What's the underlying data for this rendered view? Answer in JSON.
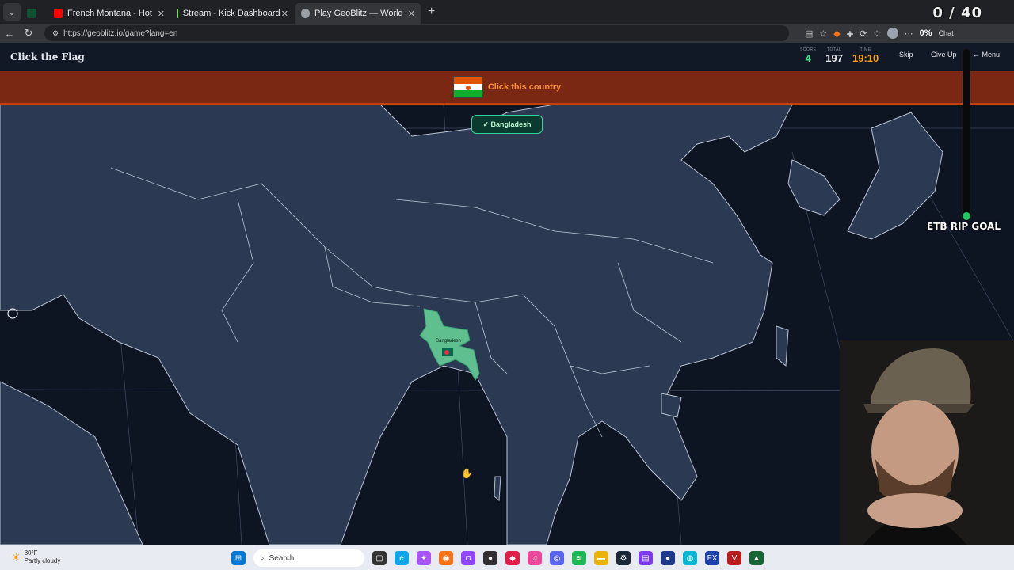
{
  "browser": {
    "tabs": [
      {
        "label": "",
        "color": "#0f5132"
      },
      {
        "label": "French Montana - Hot Boy Bling ft",
        "color": "#ff0000"
      },
      {
        "label": "Stream - Kick Dashboard",
        "color": "#53fc18"
      },
      {
        "label": "Play GeoBlitz — World Geography",
        "color": "#9aa0a6"
      }
    ],
    "url": "https://geoblitz.io/game?lang=en",
    "chat_label": "Chat",
    "percent_badge": "0%"
  },
  "overlay": {
    "counter": "0 / 40",
    "goal_label": "ETB RIP GOAL"
  },
  "game": {
    "title": "Click the Flag",
    "score_label": "SCORE",
    "score": "4",
    "total_label": "TOTAL",
    "total": "197",
    "time_label": "TIME",
    "time": "19:10",
    "skip": "Skip",
    "give_up": "Give Up",
    "menu": "← Menu",
    "prompt": "Click this country",
    "flag_colors": [
      "#e05206",
      "#ffffff",
      "#0db02b"
    ],
    "result_toast": "✓ Bangladesh",
    "highlighted_country": "Bangladesh",
    "colors": {
      "banner": "#7a2814",
      "accent": "#fb923c",
      "correct": "#5fbf8f",
      "land": "#2b3a52",
      "ocean": "#0e1522"
    }
  },
  "taskbar": {
    "temperature": "80°F",
    "condition": "Partly cloudy",
    "search_placeholder": "Search"
  }
}
